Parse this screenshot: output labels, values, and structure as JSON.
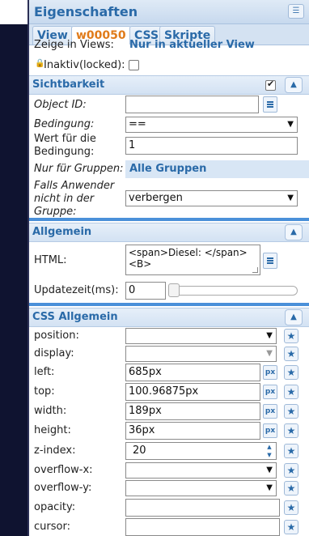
{
  "panel": {
    "title": "Eigenschaften",
    "menu_icon": "menu-icon"
  },
  "tabs": [
    {
      "label": "View"
    },
    {
      "label": "w00050"
    },
    {
      "label": "CSS"
    },
    {
      "label": "Skripte"
    }
  ],
  "general_top": {
    "zeige_label": "Zeige in Views:",
    "zeige_value": "Nur in aktueller View",
    "inaktiv_label": "Inaktiv(locked):",
    "inaktiv_checked": false
  },
  "sichtbarkeit": {
    "title": "Sichtbarkeit",
    "enabled": true,
    "object_id_label": "Object ID:",
    "object_id_value": "",
    "bedingung_label": "Bedingung:",
    "bedingung_value": "==",
    "wert_label": "Wert für die Bedingung:",
    "wert_value": "1",
    "gruppen_label": "Nur für Gruppen:",
    "gruppen_value": "Alle Gruppen",
    "falls_label": "Falls Anwender nicht in der Gruppe:",
    "falls_value": "verbergen"
  },
  "allgemein": {
    "title": "Allgemein",
    "html_label": "HTML:",
    "html_value": "<span>Diesel: </span><B>",
    "update_label": "Updatezeit(ms):",
    "update_value": "0"
  },
  "css_allgemein": {
    "title": "CSS Allgemein",
    "rows": [
      {
        "label": "position:",
        "value": "",
        "kind": "select"
      },
      {
        "label": "display:",
        "value": "",
        "kind": "select-disabled"
      },
      {
        "label": "left:",
        "value": "685px",
        "kind": "input-px"
      },
      {
        "label": "top:",
        "value": "100.96875px",
        "kind": "input-px"
      },
      {
        "label": "width:",
        "value": "189px",
        "kind": "input-px"
      },
      {
        "label": "height:",
        "value": "36px",
        "kind": "input-px"
      },
      {
        "label": "z-index:",
        "value": "20",
        "kind": "spinner"
      },
      {
        "label": "overflow-x:",
        "value": "",
        "kind": "select"
      },
      {
        "label": "overflow-y:",
        "value": "",
        "kind": "select"
      },
      {
        "label": "opacity:",
        "value": "",
        "kind": "input"
      },
      {
        "label": "cursor:",
        "value": "",
        "kind": "input"
      }
    ]
  },
  "icons": {
    "px_label": "px",
    "star": "★",
    "collapse": "▲"
  }
}
